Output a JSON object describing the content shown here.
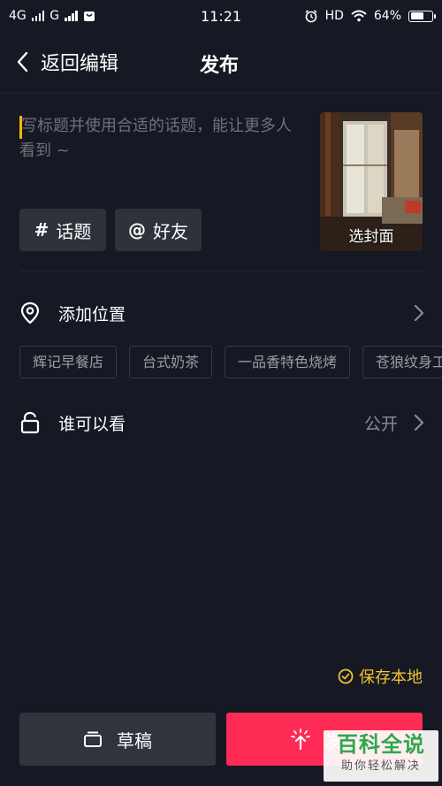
{
  "status_bar": {
    "network1": "4G",
    "network2": "G",
    "time": "11:21",
    "hd": "HD",
    "battery": "64%",
    "battery_level": 0.64
  },
  "nav": {
    "back_label": "返回编辑",
    "title": "发布"
  },
  "editor": {
    "placeholder": "写标题并使用合适的话题，能让更多人看到 ~"
  },
  "cover": {
    "label": "选封面"
  },
  "tags": {
    "topic_symbol": "#",
    "topic_label": "话题",
    "friend_symbol": "@",
    "friend_label": "好友"
  },
  "location": {
    "label": "添加位置",
    "suggestions": [
      "辉记早餐店",
      "台式奶茶",
      "一品香特色烧烤",
      "苍狼纹身工作室"
    ]
  },
  "visibility": {
    "label": "谁可以看",
    "value": "公开"
  },
  "save_local": {
    "label": "保存本地"
  },
  "actions": {
    "draft_label": "草稿",
    "publish_label": "发布"
  },
  "watermark": {
    "main": "百科全说",
    "sub": "助你轻松解决"
  },
  "colors": {
    "background": "#161823",
    "accent_red": "#fe2c55",
    "accent_yellow": "#f2c230",
    "muted_text": "#6e717a"
  }
}
